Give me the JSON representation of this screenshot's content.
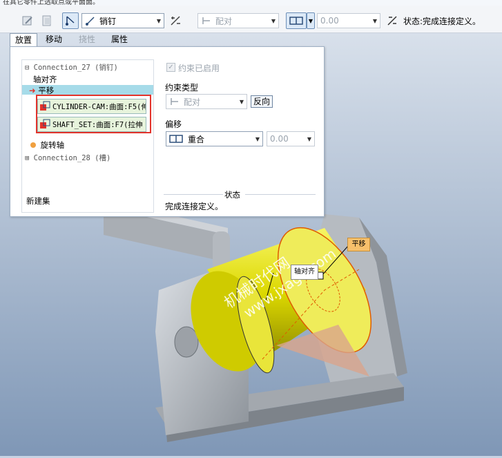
{
  "toptext": "在其它零件上选取点或平面面。",
  "toolbar": {
    "connection_type": "销钉",
    "constraint_value": "配对",
    "offset_value": "0.00",
    "status": "状态:完成连接定义。"
  },
  "tabs": [
    {
      "label": "放置"
    },
    {
      "label": "移动"
    },
    {
      "label": "挠性"
    },
    {
      "label": "属性"
    }
  ],
  "tree": {
    "conn27": "Connection_27 (销钉)",
    "axis_align": "轴对齐",
    "translate": "平移",
    "ref1": "CYLINDER-CAM:曲面:F5(伸",
    "ref2": "SHAFT_SET:曲面:F7(拉伸",
    "rotation_axis": "旋转轴",
    "conn28": "Connection_28 (槽)",
    "new_set": "新建集"
  },
  "right": {
    "constraint_enabled": "约束已启用",
    "constraint_type_label": "约束类型",
    "constraint_type_value": "配对",
    "reverse": "反向",
    "offset_label": "偏移",
    "offset_type": "重合",
    "offset_value": "0.00",
    "status_label": "状态",
    "status_text": "完成连接定义。"
  },
  "viewport": {
    "tag_translate": "平移",
    "tag_axis": "轴对齐",
    "watermark1": "机械时代网",
    "watermark2": "www.jxage.com"
  },
  "colors": {
    "accent_red": "#e3332b",
    "selection": "#a6dbe9",
    "tag_orange": "#f7c06b",
    "part_yellow": "#e8e400"
  }
}
